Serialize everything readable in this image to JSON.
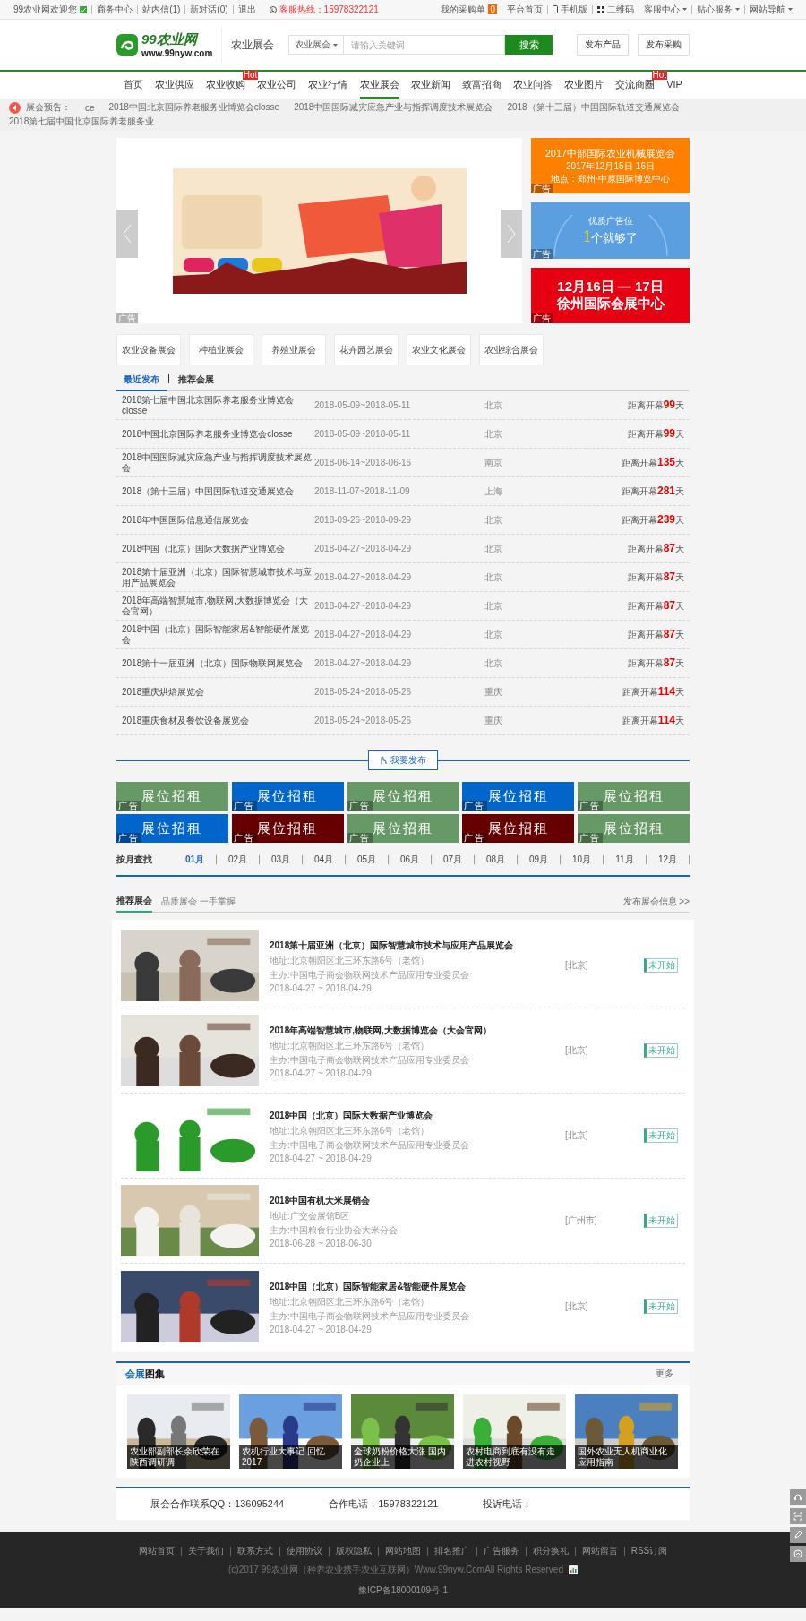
{
  "topbar": {
    "left": [
      {
        "label": "99农业网欢迎您",
        "kind": "welcome"
      },
      {
        "label": "商务中心",
        "kind": "link"
      },
      {
        "label": "站内信(1)",
        "kind": "link"
      },
      {
        "label": "新对话(0)",
        "kind": "link"
      },
      {
        "label": "退出",
        "kind": "link"
      }
    ],
    "hotline": "客服热线：15978322121",
    "right": [
      {
        "label": "我的采购单",
        "badge": "0",
        "kind": "cart"
      },
      {
        "label": "平台首页",
        "kind": "link"
      },
      {
        "label": "手机版",
        "kind": "mobile"
      },
      {
        "label": "二维码",
        "kind": "qr"
      },
      {
        "label": "客服中心",
        "kind": "menu"
      },
      {
        "label": "贴心服务",
        "kind": "menu"
      },
      {
        "label": "网站导航",
        "kind": "menu"
      }
    ]
  },
  "header": {
    "logo": {
      "name": "99农业网",
      "url": "www.99nyw.com"
    },
    "channel": "农业展会",
    "search": {
      "scope": "农业展会",
      "placeholder": "请输入关键词",
      "button": "搜索"
    },
    "actions": [
      "发布产品",
      "发布采购"
    ]
  },
  "nav": [
    {
      "label": "首页",
      "selected": false
    },
    {
      "label": "农业供应",
      "selected": false
    },
    {
      "label": "农业收购",
      "selected": false,
      "badge": "Hot"
    },
    {
      "label": "农业公司",
      "selected": false
    },
    {
      "label": "农业行情",
      "selected": false
    },
    {
      "label": "农业展会",
      "selected": true
    },
    {
      "label": "农业新闻",
      "selected": false
    },
    {
      "label": "致富招商",
      "selected": false
    },
    {
      "label": "农业问答",
      "selected": false
    },
    {
      "label": "农业图片",
      "selected": false
    },
    {
      "label": "交流商圈",
      "selected": false,
      "badge": "Hot"
    },
    {
      "label": "VIP",
      "selected": false
    }
  ],
  "ticker": {
    "label": "展会预告：",
    "items": [
      "ce",
      "2018中国北京国际养老服务业博览会closse",
      "2018中国国际减灾应急产业与指挥调度技术展览会",
      "2018（第十三届）中国国际轨道交通展览会",
      "2018第七届中国北京国际养老服务业"
    ]
  },
  "banner": {
    "ad_label": "广告"
  },
  "side_ads": [
    {
      "kind": "event",
      "color": "#ff7f00",
      "lines": [
        "2017中部国际农业机械展览会",
        "2017年12月15日-16日",
        "地点：郑州·中原国际博览中心"
      ],
      "ad_label": "广告"
    },
    {
      "kind": "promo",
      "color": "#5b9fe0",
      "lines": [
        "优质广告位",
        "1",
        "个就够了"
      ],
      "ad_label": "广告"
    },
    {
      "kind": "bold",
      "color": "#e60012",
      "lines": [
        "12月16日 — 17日",
        "徐州国际会展中心"
      ],
      "ad_label": "广告"
    }
  ],
  "categories": [
    "农业设备展会",
    "种植业展会",
    "养殖业展会",
    "花卉园艺展会",
    "农业文化展会",
    "农业综合展会"
  ],
  "list_tabs": [
    {
      "label": "最近发布",
      "selected": true
    },
    {
      "label": "推荐会展",
      "selected": false
    }
  ],
  "expos": [
    {
      "name": "2018第七届中国北京国际养老服务业博览会closse",
      "dates": "2018-05-09~2018-05-11",
      "city": "北京",
      "countdown": "距离开幕**99**天"
    },
    {
      "name": "2018中国北京国际养老服务业博览会closse",
      "dates": "2018-05-09~2018-05-11",
      "city": "北京",
      "countdown": "距离开幕**99**天"
    },
    {
      "name": "2018中国国际减灾应急产业与指挥调度技术展览会",
      "dates": "2018-06-14~2018-06-16",
      "city": "南京",
      "countdown": "距离开幕**135**天"
    },
    {
      "name": "2018（第十三届）中国国际轨道交通展览会",
      "dates": "2018-11-07~2018-11-09",
      "city": "上海",
      "countdown": "距离开幕**281**天"
    },
    {
      "name": "2018年中国国际信息通信展览会",
      "dates": "2018-09-26~2018-09-29",
      "city": "北京",
      "countdown": "距离开幕**239**天"
    },
    {
      "name": "2018中国（北京）国际大数据产业博览会",
      "dates": "2018-04-27~2018-04-29",
      "city": "北京",
      "countdown": "距离开幕**87**天"
    },
    {
      "name": "2018第十届亚洲（北京）国际智慧城市技术与应用产品展览会",
      "dates": "2018-04-27~2018-04-29",
      "city": "北京",
      "countdown": "距离开幕**87**天"
    },
    {
      "name": "2018年高端智慧城市,物联网,大数据博览会（大会官网）",
      "dates": "2018-04-27~2018-04-29",
      "city": "北京",
      "countdown": "距离开幕**87**天"
    },
    {
      "name": "2018中国（北京）国际智能家居&智能硬件展览会",
      "dates": "2018-04-27~2018-04-29",
      "city": "北京",
      "countdown": "距离开幕**87**天"
    },
    {
      "name": "2018第十一届亚洲（北京）国际物联网展览会",
      "dates": "2018-04-27~2018-04-29",
      "city": "北京",
      "countdown": "距离开幕**87**天"
    },
    {
      "name": "2018重庆烘焙展览会",
      "dates": "2018-05-24~2018-05-26",
      "city": "重庆",
      "countdown": "距离开幕**114**天"
    },
    {
      "name": "2018重庆食材及餐饮设备展览会",
      "dates": "2018-05-24~2018-05-26",
      "city": "重庆",
      "countdown": "距离开幕**114**天"
    }
  ],
  "publish_button": "我要发布",
  "rentals": [
    {
      "label": "展位招租",
      "color": "#669966",
      "ad_label": "广告"
    },
    {
      "label": "展位招租",
      "color": "#0066cc",
      "ad_label": "广告"
    },
    {
      "label": "展位招租",
      "color": "#669966",
      "ad_label": "广告"
    },
    {
      "label": "展位招租",
      "color": "#0066cc",
      "ad_label": "广告"
    },
    {
      "label": "展位招租",
      "color": "#669966",
      "ad_label": "广告"
    },
    {
      "label": "展位招租",
      "color": "#0066cc",
      "ad_label": "广告"
    },
    {
      "label": "展位招租",
      "color": "#660000",
      "ad_label": "广告"
    },
    {
      "label": "展位招租",
      "color": "#669966",
      "ad_label": "广告"
    },
    {
      "label": "展位招租",
      "color": "#660000",
      "ad_label": "广告"
    },
    {
      "label": "展位招租",
      "color": "#669966",
      "ad_label": "广告"
    }
  ],
  "months": {
    "label": "按月查找",
    "items": [
      {
        "label": "01月",
        "selected": true
      },
      {
        "label": "02月",
        "selected": false
      },
      {
        "label": "03月",
        "selected": false
      },
      {
        "label": "04月",
        "selected": false
      },
      {
        "label": "05月",
        "selected": false
      },
      {
        "label": "06月",
        "selected": false
      },
      {
        "label": "07月",
        "selected": false
      },
      {
        "label": "08月",
        "selected": false
      },
      {
        "label": "09月",
        "selected": false
      },
      {
        "label": "10月",
        "selected": false
      },
      {
        "label": "11月",
        "selected": false
      },
      {
        "label": "12月",
        "selected": false
      }
    ]
  },
  "recommended": {
    "title": "推荐展会",
    "subtitle": "品质展会 一手掌握",
    "more": "发布展会信息 >>",
    "items": [
      {
        "title": "2018第十届亚洲（北京）国际智慧城市技术与应用产品展览会",
        "address": "地址:北京朝阳区北三环东路6号（老馆）",
        "organizer": "主办:中国电子商会物联网技术产品应用专业委员会",
        "dates": "2018-04-27 ~ 2018-04-29",
        "city": "[北京]",
        "status": "未开始"
      },
      {
        "title": "2018年高端智慧城市,物联网,大数据博览会（大会官网）",
        "address": "地址:北京朝阳区北三环东路6号（老馆）",
        "organizer": "主办:中国电子商会物联网技术产品应用专业委员会",
        "dates": "2018-04-27 ~ 2018-04-29",
        "city": "[北京]",
        "status": "未开始"
      },
      {
        "title": "2018中国（北京）国际大数据产业博览会",
        "address": "地址:北京朝阳区北三环东路6号（老馆）",
        "organizer": "主办:中国电子商会物联网技术产品应用专业委员会",
        "dates": "2018-04-27 ~ 2018-04-29",
        "city": "[北京]",
        "status": "未开始"
      },
      {
        "title": "2018中国有机大米展销会",
        "address": "地址:广交会展馆B区",
        "organizer": "主办:中国粮食行业协会大米分会",
        "dates": "2018-06-28 ~ 2018-06-30",
        "city": "[广州市]",
        "status": "未开始"
      },
      {
        "title": "2018中国（北京）国际智能家居&智能硬件展览会",
        "address": "地址:北京朝阳区北三环东路6号（老馆）",
        "organizer": "主办:中国电子商会物联网技术产品应用专业委员会",
        "dates": "2018-04-27 ~ 2018-04-29",
        "city": "[北京]",
        "status": "未开始"
      }
    ]
  },
  "gallery": {
    "title_accent": "会展",
    "title_rest": "图集",
    "more": "更多",
    "items": [
      "农业部副部长余欣荣在陕西调研调",
      "农机行业大事记 回忆2017",
      "全球奶粉价格大涨 国内奶企业上",
      "农村电商到底有没有走进农村视野",
      "国外农业无人机商业化应用指南"
    ]
  },
  "contact": [
    "展会合作联系QQ：136095244",
    "合作电话：15978322121",
    "投诉电话："
  ],
  "footer": {
    "links": [
      "网站首页",
      "关于我们",
      "联系方式",
      "使用协议",
      "版权隐私",
      "网站地图",
      "排名推广",
      "广告服务",
      "积分换礼",
      "网站留言",
      "RSS订阅"
    ],
    "copyright": "(c)2017 99农业网（种养农业携手农业互联网）Www.99nyw.ComAll Rights Reserved",
    "icp": "豫ICP备18000109号-1"
  }
}
